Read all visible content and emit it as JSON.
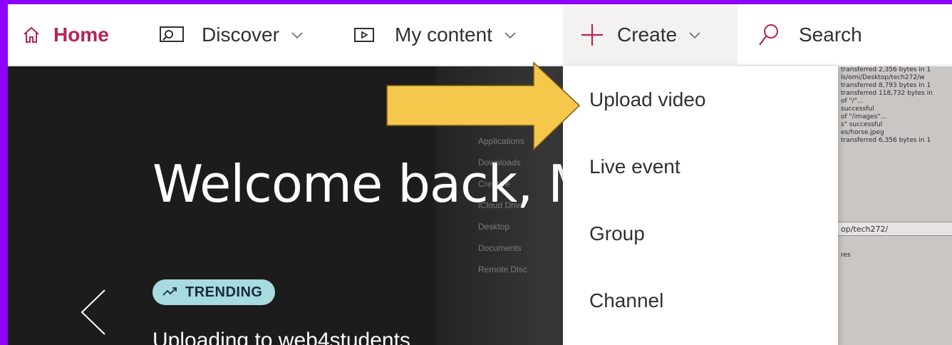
{
  "colors": {
    "frame": "#8f00ff",
    "home_accent": "#b4235a",
    "trending_badge": "#a7dbdf",
    "arrow": "#f5c74b"
  },
  "nav": {
    "home": {
      "label": "Home",
      "icon": "home-icon"
    },
    "discover": {
      "label": "Discover",
      "icon": "discover-icon"
    },
    "my_content": {
      "label": "My content",
      "icon": "play-icon"
    },
    "create": {
      "label": "Create",
      "icon": "plus-icon"
    },
    "search": {
      "label": "Search",
      "icon": "search-icon"
    }
  },
  "create_menu": {
    "items": [
      {
        "label": "Upload video"
      },
      {
        "label": "Live event"
      },
      {
        "label": "Group"
      },
      {
        "label": "Channel"
      }
    ]
  },
  "hero": {
    "welcome": "Welcome back, M",
    "badge": "TRENDING",
    "subtitle": "Uploading to web4students"
  },
  "background_screenshot": {
    "sidebar": [
      "Applications",
      "Downloads",
      "Creative",
      "iCloud Drive",
      "Desktop",
      "Documents",
      "Remote Disc"
    ],
    "log_lines": [
      "transferred 2,356 bytes in 1",
      "ls/omi/Desktop/tech272/w",
      "transferred 8,793 bytes in 1",
      "transferred 118,732 bytes in",
      "of \"/\"...",
      "successful",
      "of \"/images\"...",
      "s\" successful",
      "es/horse.jpeg",
      "transferred 6,356 bytes in 1"
    ],
    "path": "op/tech272/",
    "res": "res"
  }
}
